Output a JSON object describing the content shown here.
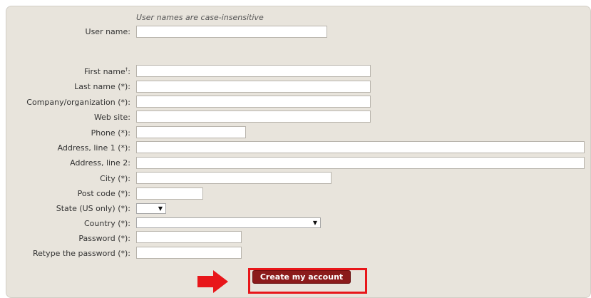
{
  "form": {
    "hint": "User names are case-insensitive",
    "username_label": "User name:",
    "firstname_label": "First name",
    "firstname_mark": "†",
    "firstname_colon": ":",
    "lastname_label": "Last name (*):",
    "company_label": "Company/organization (*):",
    "website_label": "Web site:",
    "phone_label": "Phone (*):",
    "address1_label": "Address, line 1 (*):",
    "address2_label": "Address, line 2:",
    "city_label": "City (*):",
    "postcode_label": "Post code (*):",
    "state_label": "State (US only) (*):",
    "country_label": "Country (*):",
    "password_label": "Password (*):",
    "retype_label": "Retype the password (*):",
    "submit_label": "Create my account"
  },
  "colors": {
    "panel_bg": "#e8e4dc",
    "button_bg": "#8b1b1b",
    "highlight": "#e8161a"
  },
  "icons": {
    "dropdown": "chevron-down-icon",
    "annotation": "arrow-right-icon"
  }
}
